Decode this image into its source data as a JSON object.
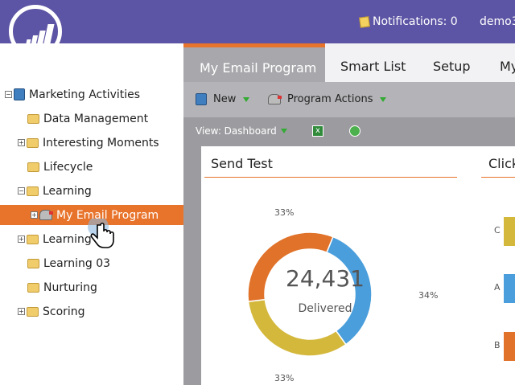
{
  "header": {
    "notifications": "Notifications: 0",
    "user": "demo3"
  },
  "sidebar": {
    "items": [
      {
        "label": "Marketing Activities",
        "icon": "program-book-icon",
        "expander": "minus"
      },
      {
        "label": "Data Management",
        "icon": "folder-icon",
        "expander": ""
      },
      {
        "label": "Interesting Moments",
        "icon": "folder-icon",
        "expander": "plus"
      },
      {
        "label": "Lifecycle",
        "icon": "folder-icon",
        "expander": ""
      },
      {
        "label": "Learning",
        "icon": "folder-icon",
        "expander": "minus"
      },
      {
        "label": "My Email Program",
        "icon": "mailbox-icon",
        "expander": "plus",
        "selected": true
      },
      {
        "label": "Learning",
        "icon": "folder-icon",
        "expander": "plus"
      },
      {
        "label": "Learning 03",
        "icon": "folder-icon",
        "expander": ""
      },
      {
        "label": "Nurturing",
        "icon": "folder-icon",
        "expander": ""
      },
      {
        "label": "Scoring",
        "icon": "folder-icon",
        "expander": "plus"
      }
    ]
  },
  "tabs": [
    "My Email Program",
    "Smart List",
    "Setup",
    "My"
  ],
  "toolbar": {
    "new": "New",
    "program_actions": "Program Actions",
    "view": "View: Dashboard"
  },
  "send_test": {
    "title": "Send Test",
    "chart_data": {
      "type": "pie",
      "donut": true,
      "center_value": "24,431",
      "center_label": "Delivered",
      "slices": [
        {
          "label": "34%",
          "value": 34,
          "color": "#4a9edb"
        },
        {
          "label": "33%",
          "value": 33,
          "color": "#d4b83c"
        },
        {
          "label": "33%",
          "value": 33,
          "color": "#e0722a"
        }
      ]
    }
  },
  "clicks": {
    "title": "Click",
    "bars": [
      {
        "label": "C",
        "color": "#d4b83c"
      },
      {
        "label": "A",
        "color": "#4a9edb"
      },
      {
        "label": "B",
        "color": "#e0722a"
      }
    ]
  },
  "colors": {
    "brand": "#5c54a4",
    "accent": "#e8732a"
  }
}
